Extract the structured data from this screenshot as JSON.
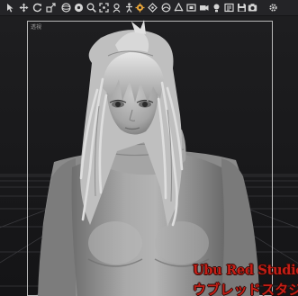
{
  "toolbar": {
    "icons": [
      "select-icon",
      "translate-icon",
      "rotate-icon",
      "scale-icon",
      "orbit-icon",
      "pan-icon",
      "zoom-icon",
      "frame-icon",
      "node-select-icon",
      "active-pose-icon",
      "joint-editor-icon",
      "region-icon",
      "surface-icon",
      "geometry-editor-icon",
      "spot-render-icon",
      "camera-icon",
      "light-icon",
      "render-settings-icon",
      "save-icon",
      "render-icon",
      "settings-icon"
    ]
  },
  "viewport": {
    "camera_name": "透視",
    "frame_color": "#b8b8b8"
  },
  "watermark": {
    "line1": "Ubu Red Studio",
    "line2": "ウブレッドスタジオ",
    "color": "#c51f17"
  }
}
